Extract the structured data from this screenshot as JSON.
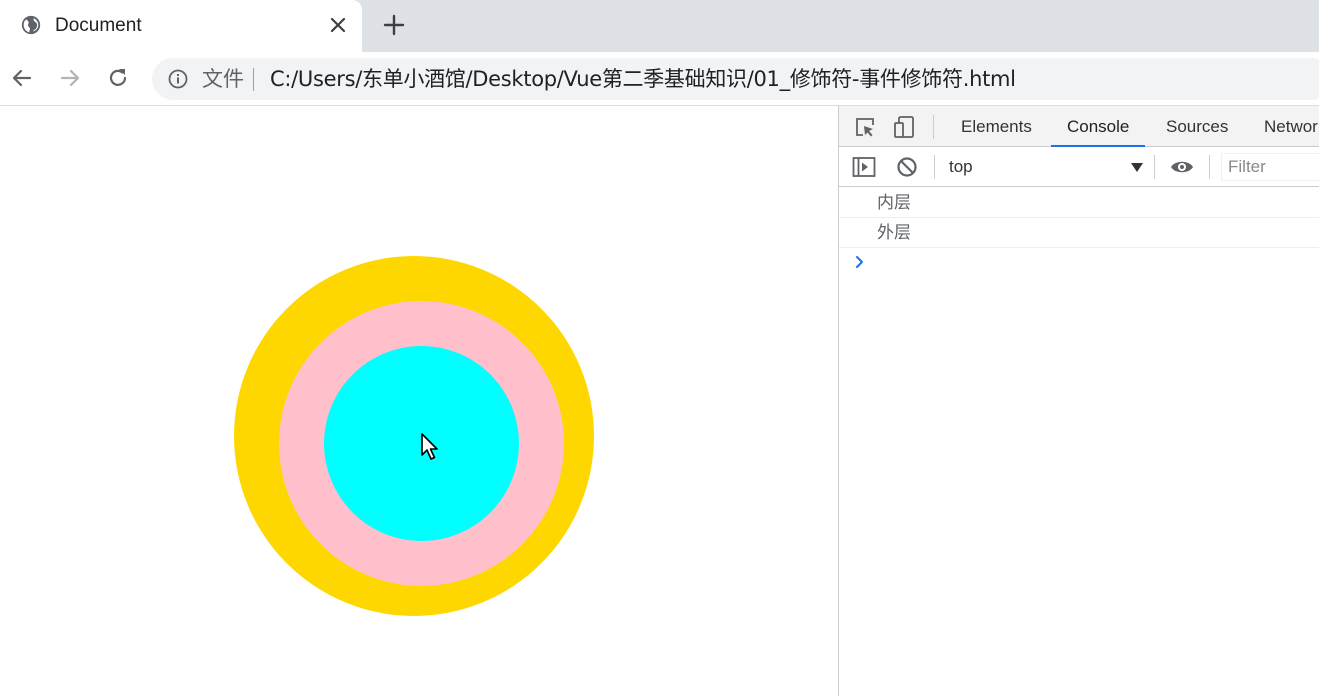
{
  "browser": {
    "tab": {
      "title": "Document",
      "favicon": "globe-icon",
      "close_icon": "close-icon"
    },
    "new_tab_icon": "plus-icon",
    "toolbar": {
      "back_icon": "arrow-left-icon",
      "forward_icon": "arrow-right-icon",
      "reload_icon": "reload-icon",
      "info_icon": "info-icon",
      "scheme_label": "文件",
      "url": "C:/Users/东单小酒馆/Desktop/Vue第二季基础知识/01_修饰符-事件修饰符.html"
    }
  },
  "page": {
    "circles": {
      "outer_color": "#ffd700",
      "middle_color": "#ffc0cb",
      "inner_color": "#00ffff"
    },
    "cursor_icon": "pointer-cursor-icon"
  },
  "devtools": {
    "icons": {
      "inspect": "inspect-element-icon",
      "device": "device-toolbar-icon"
    },
    "tabs": [
      {
        "label": "Elements",
        "active": false
      },
      {
        "label": "Console",
        "active": true
      },
      {
        "label": "Sources",
        "active": false
      },
      {
        "label": "Network",
        "active": false
      }
    ],
    "console_toolbar": {
      "sidebar_icon": "show-sidebar-icon",
      "clear_icon": "clear-console-icon",
      "context": "top",
      "eye_icon": "eye-icon",
      "filter_placeholder": "Filter"
    },
    "logs": [
      "内层",
      "外层"
    ],
    "prompt_icon": "chevron-right-icon",
    "accent_color": "#1a73e8"
  }
}
